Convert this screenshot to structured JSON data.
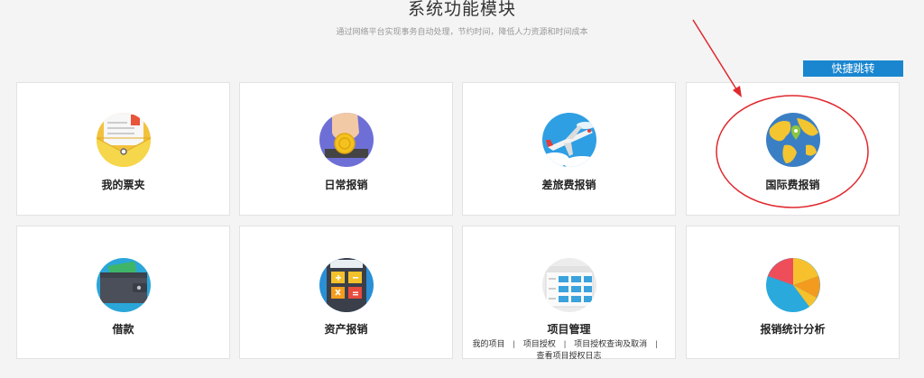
{
  "header": {
    "title": "系统功能模块",
    "subtitle": "通过网络平台实现事务自动处理，节约时间，降低人力资源和时间成本"
  },
  "quick_jump_label": "快捷跳转",
  "modules": [
    {
      "label": "我的票夹",
      "icon": "invoice-folder-icon"
    },
    {
      "label": "日常报销",
      "icon": "coin-hand-icon"
    },
    {
      "label": "差旅费报销",
      "icon": "airplane-icon"
    },
    {
      "label": "国际费报销",
      "icon": "globe-icon"
    },
    {
      "label": "借款",
      "icon": "wallet-icon"
    },
    {
      "label": "资产报销",
      "icon": "calculator-icon"
    },
    {
      "label": "项目管理",
      "icon": "project-grid-icon",
      "links": [
        "我的项目",
        "项目授权",
        "项目授权查询及取消",
        "查看项目授权日志"
      ]
    },
    {
      "label": "报销统计分析",
      "icon": "pie-chart-icon"
    }
  ],
  "colors": {
    "accent": "#1a86d0",
    "annotation": "#e0282d"
  }
}
